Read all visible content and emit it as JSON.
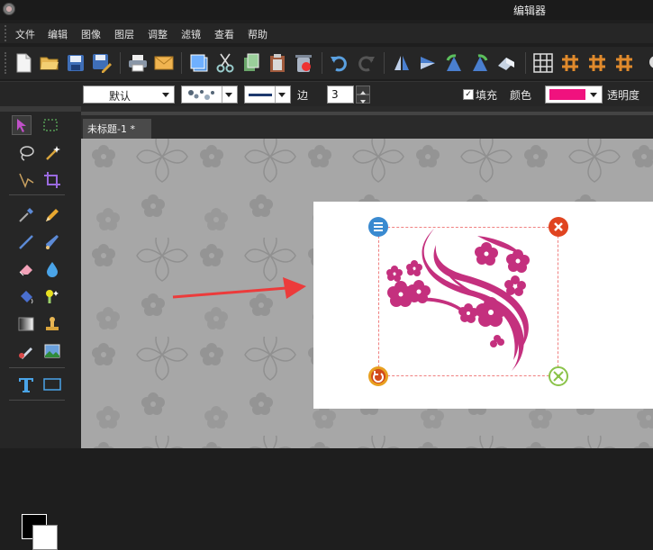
{
  "window": {
    "title": "编辑器"
  },
  "menu": [
    "文件",
    "编辑",
    "图像",
    "图层",
    "调整",
    "滤镜",
    "查看",
    "帮助"
  ],
  "toolbar": {
    "buttons": [
      "new-file-icon",
      "open-folder-icon",
      "save-icon",
      "save-as-icon",
      "print-icon",
      "email-icon",
      "copy-window-icon",
      "cut-icon",
      "copy-icon",
      "paste-icon",
      "delete-icon",
      "undo-icon",
      "redo-icon",
      "flip-horizontal-icon",
      "flip-vertical-icon",
      "rotate-left-icon",
      "rotate-right-icon",
      "rotate-free-icon",
      "grid-icon",
      "hash-icon",
      "hash-bold-icon",
      "hash-fill-icon"
    ]
  },
  "options": {
    "preset": "默认",
    "edge_label": "边",
    "edge_value": "3",
    "fill_label": "填充",
    "fill_checked": true,
    "color_label": "颜色",
    "fill_color": "#f0127e",
    "opacity_label": "透明度"
  },
  "tabs": [
    {
      "label": "未标题-1 *"
    }
  ],
  "colors": {
    "foreground": "#000000",
    "background": "#ffffff",
    "flower": "#c4307e",
    "arrow": "#ec3b3b"
  }
}
